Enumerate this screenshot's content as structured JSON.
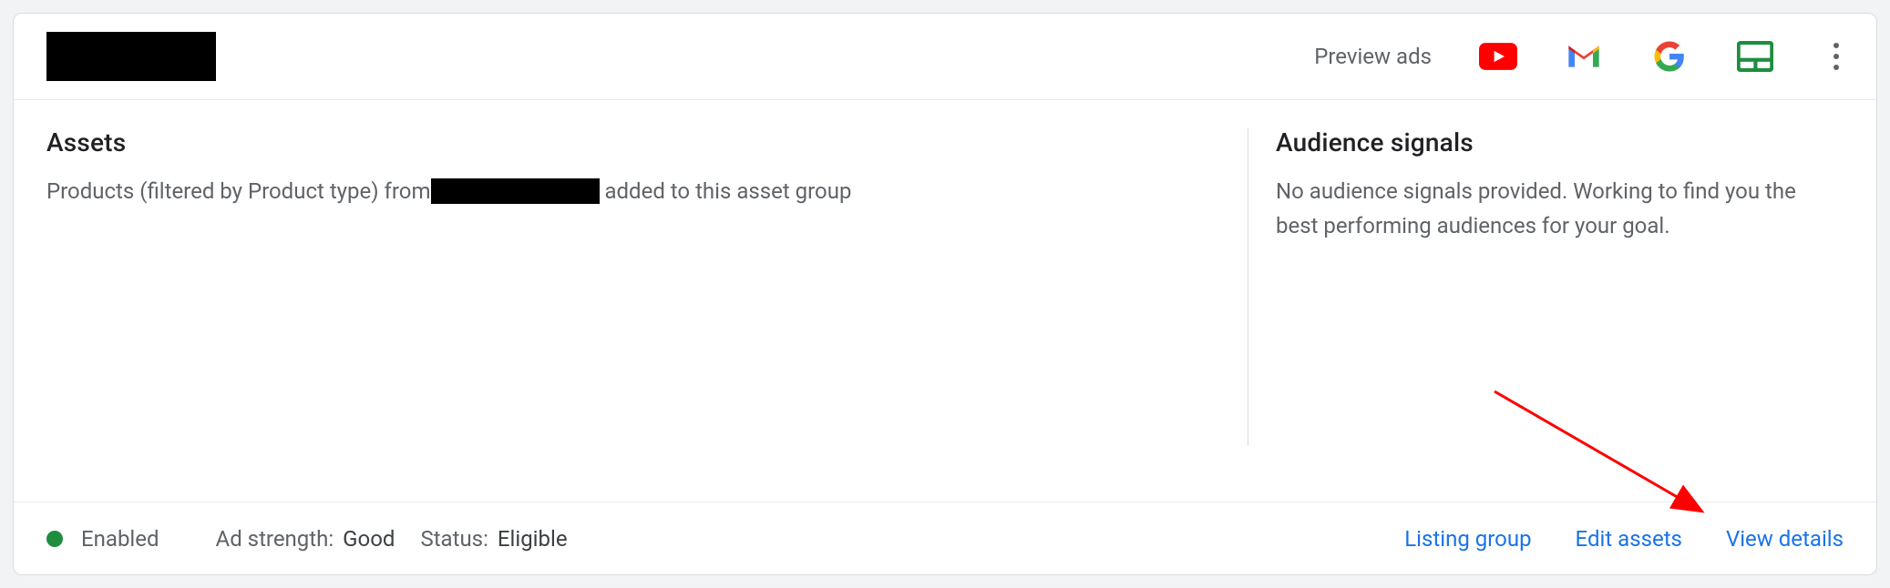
{
  "header": {
    "preview_label": "Preview ads"
  },
  "assets": {
    "title": "Assets",
    "desc_prefix": "Products (filtered by Product type) from",
    "desc_suffix": " added to this asset group"
  },
  "audience": {
    "title": "Audience signals",
    "text": "No audience signals provided. Working to find you the best performing audiences for your goal."
  },
  "footer": {
    "enabled_label": "Enabled",
    "ad_strength_label": "Ad strength:",
    "ad_strength_value": "Good",
    "status_label": "Status:",
    "status_value": "Eligible",
    "listing_group": "Listing group",
    "edit_assets": "Edit assets",
    "view_details": "View details"
  }
}
